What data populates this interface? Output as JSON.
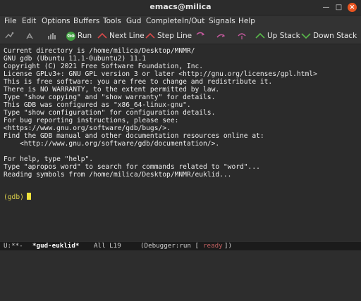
{
  "window": {
    "title": "emacs@milica"
  },
  "menubar": {
    "items": [
      "File",
      "Edit",
      "Options",
      "Buffers",
      "Tools",
      "Gud",
      "Complete",
      "In/Out",
      "Signals",
      "Help"
    ]
  },
  "toolbar": {
    "go_label": "Go",
    "run_label": "Run",
    "next_line_label": "Next Line",
    "step_line_label": "Step Line",
    "up_stack_label": "Up Stack",
    "down_stack_label": "Down Stack"
  },
  "terminal": {
    "lines": [
      "Current directory is /home/milica/Desktop/MNMR/",
      "GNU gdb (Ubuntu 11.1-0ubuntu2) 11.1",
      "Copyright (C) 2021 Free Software Foundation, Inc.",
      "License GPLv3+: GNU GPL version 3 or later <http://gnu.org/licenses/gpl.html>",
      "This is free software: you are free to change and redistribute it.",
      "There is NO WARRANTY, to the extent permitted by law.",
      "Type \"show copying\" and \"show warranty\" for details.",
      "This GDB was configured as \"x86_64-linux-gnu\".",
      "Type \"show configuration\" for configuration details.",
      "For bug reporting instructions, please see:",
      "<https://www.gnu.org/software/gdb/bugs/>.",
      "Find the GDB manual and other documentation resources online at:",
      "    <http://www.gnu.org/software/gdb/documentation/>.",
      "",
      "For help, type \"help\".",
      "Type \"apropos word\" to search for commands related to \"word\"...",
      "Reading symbols from /home/milica/Desktop/MNMR/euklid..."
    ],
    "prompt": "(gdb)"
  },
  "modeline": {
    "status": "U:**-",
    "buffer": "*gud-euklid*",
    "position": "All L19",
    "mode": "(Debugger:run [",
    "state": "ready",
    "mode_close": "])"
  },
  "colors": {
    "prompt": "#dfd34a",
    "cursor": "#f0e33c",
    "close_button": "#e95420",
    "go_icon": "#3fa03f"
  }
}
